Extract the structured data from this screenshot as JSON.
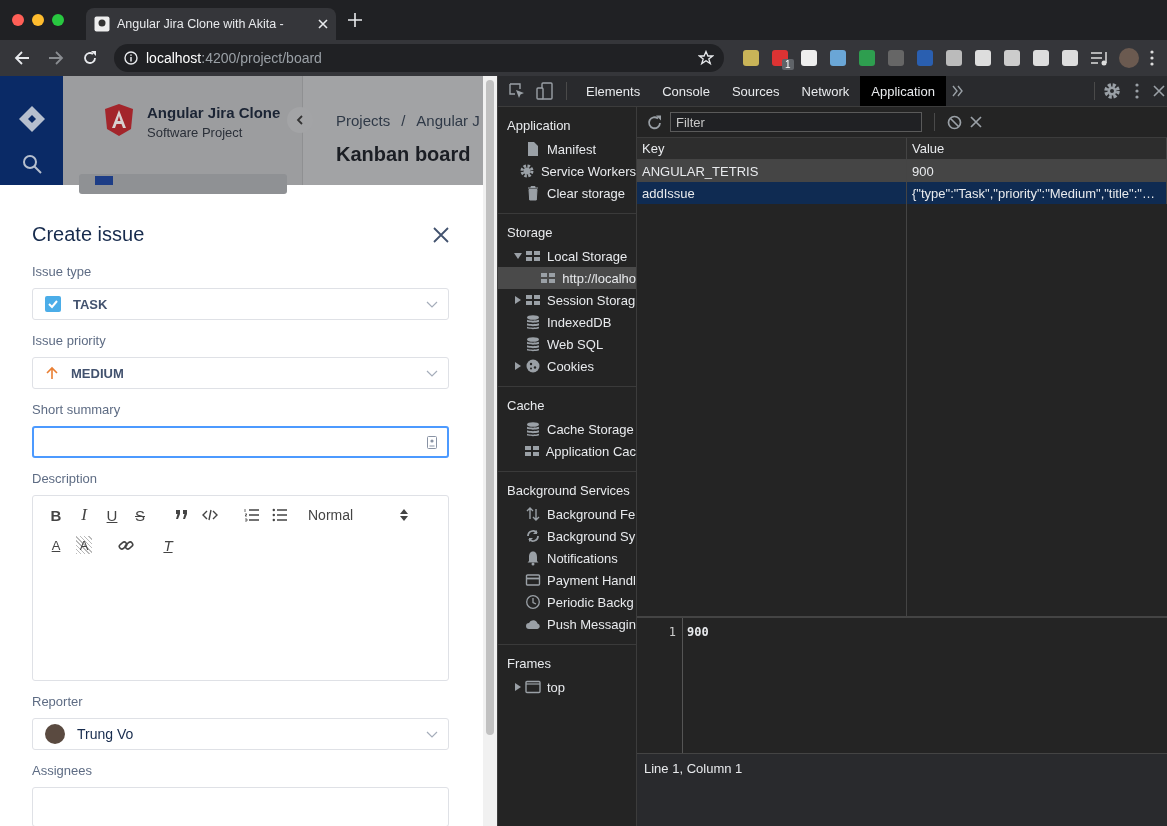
{
  "browser": {
    "tab_title": "Angular Jira Clone with Akita -",
    "url_host": "localhost",
    "url_rest": ":4200/project/board",
    "extension_badge": "1"
  },
  "app": {
    "project_name": "Angular Jira Clone",
    "project_type": "Software Project",
    "breadcrumbs": [
      "Projects",
      "/",
      "Angular J"
    ],
    "page_title": "Kanban board"
  },
  "modal": {
    "title": "Create issue",
    "fields": [
      {
        "kind": "issue-type",
        "label": "Issue type",
        "value": "TASK"
      },
      {
        "kind": "priority",
        "label": "Issue priority",
        "value": "MEDIUM"
      },
      {
        "kind": "text",
        "label": "Short summary",
        "focused": true
      },
      {
        "kind": "editor",
        "label": "Description",
        "format": "Normal",
        "tools": [
          {
            "kind": "bold",
            "glyph": "B"
          },
          {
            "kind": "italic",
            "glyph": "I"
          },
          {
            "kind": "underline",
            "glyph": "U"
          },
          {
            "kind": "strike",
            "glyph": "S"
          },
          {
            "kind": "quote"
          },
          {
            "kind": "code"
          },
          {
            "kind": "ordered-list"
          },
          {
            "kind": "bullet-list"
          },
          {
            "kind": "format"
          },
          {
            "kind": "text-color",
            "glyph": "A"
          },
          {
            "kind": "background",
            "glyph": "A"
          },
          {
            "kind": "link"
          },
          {
            "kind": "clean",
            "glyph": "T"
          }
        ]
      },
      {
        "kind": "user",
        "label": "Reporter",
        "value": "Trung Vo"
      },
      {
        "kind": "multi",
        "label": "Assignees"
      }
    ]
  },
  "devtools": {
    "tabs": [
      {
        "label": "Elements",
        "selected": false
      },
      {
        "label": "Console",
        "selected": false
      },
      {
        "label": "Sources",
        "selected": false
      },
      {
        "label": "Network",
        "selected": false
      },
      {
        "label": "Application",
        "selected": true
      }
    ],
    "sidebar": [
      {
        "title": "Application",
        "items": [
          {
            "label": "Manifest",
            "kind": "file",
            "selected": false
          },
          {
            "label": "Service Workers",
            "kind": "gear",
            "selected": false
          },
          {
            "label": "Clear storage",
            "kind": "trash",
            "selected": false
          }
        ]
      },
      {
        "title": "Storage",
        "items": [
          {
            "label": "Local Storage",
            "kind": "grid",
            "expanded": true,
            "selected": false,
            "children": [
              {
                "label": "http://localho",
                "kind": "grid",
                "selected": true
              }
            ]
          },
          {
            "label": "Session Storag",
            "kind": "grid",
            "expanded": false,
            "selected": false
          },
          {
            "label": "IndexedDB",
            "kind": "db",
            "selected": false
          },
          {
            "label": "Web SQL",
            "kind": "db",
            "selected": false
          },
          {
            "label": "Cookies",
            "kind": "cookie",
            "expanded": false,
            "selected": false
          }
        ]
      },
      {
        "title": "Cache",
        "items": [
          {
            "label": "Cache Storage",
            "kind": "db",
            "selected": false
          },
          {
            "label": "Application Cac",
            "kind": "grid",
            "selected": false
          }
        ]
      },
      {
        "title": "Background Services",
        "items": [
          {
            "label": "Background Fe",
            "kind": "updown",
            "selected": false
          },
          {
            "label": "Background Sy",
            "kind": "sync",
            "selected": false
          },
          {
            "label": "Notifications",
            "kind": "bell",
            "selected": false
          },
          {
            "label": "Payment Handl",
            "kind": "card",
            "selected": false
          },
          {
            "label": "Periodic Backg",
            "kind": "clock",
            "selected": false
          },
          {
            "label": "Push Messagin",
            "kind": "cloud",
            "selected": false
          }
        ]
      },
      {
        "title": "Frames",
        "items": [
          {
            "label": "top",
            "kind": "frame",
            "expanded": false,
            "selected": false
          }
        ]
      }
    ],
    "filter_placeholder": "Filter",
    "table": {
      "columns": [
        "Key",
        "Value"
      ],
      "rows": [
        {
          "key": "ANGULAR_TETRIS",
          "value": "900",
          "selected": false,
          "hovered": true
        },
        {
          "key": "addIssue",
          "value": "{\"type\":\"Task\",\"priority\":\"Medium\",\"title\":\"…",
          "selected": true,
          "hovered": false
        }
      ]
    },
    "preview": {
      "line_number": "1",
      "content": "900"
    },
    "status": "Line 1, Column 1"
  }
}
